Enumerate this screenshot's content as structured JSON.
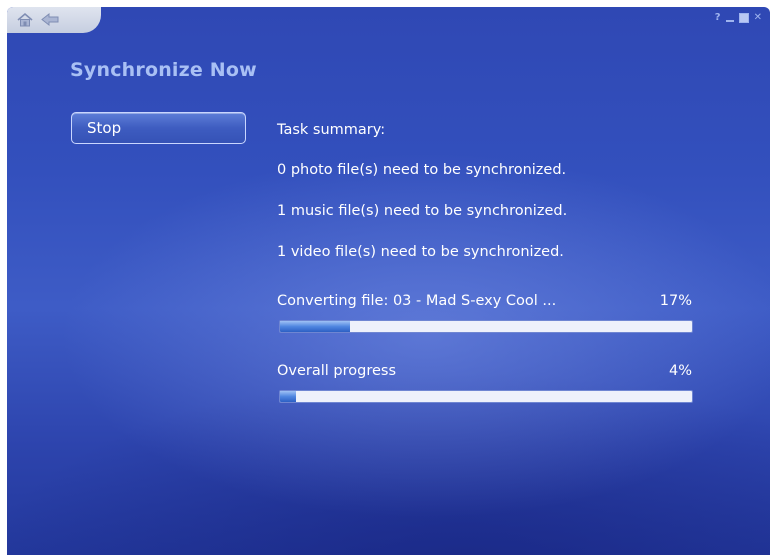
{
  "window": {
    "title": "Synchronize Now"
  },
  "titlebar": {
    "icons": [
      "home-icon",
      "back-icon",
      "help-icon",
      "minimize-icon",
      "maximize-icon",
      "close-icon"
    ],
    "help_glyph": "?",
    "close_glyph": "✕"
  },
  "sidebar": {
    "stop_label": "Stop"
  },
  "summary": {
    "heading": "Task summary:",
    "lines": [
      "0 photo file(s) need to be synchronized.",
      "1 music file(s) need to be synchronized.",
      "1 video file(s) need to be synchronized."
    ]
  },
  "progress": {
    "current": {
      "label": "Converting file: 03 - Mad S-exy Cool ...",
      "percent_text": "17%",
      "value": 0.17
    },
    "overall": {
      "label": "Overall progress",
      "percent_text": "4%",
      "value": 0.04
    }
  },
  "colors": {
    "background": "#3350bd",
    "title": "#a9c0f4",
    "text": "#ffffff",
    "progress_fill": "#4f86e0",
    "progress_track": "#eef1fb"
  }
}
